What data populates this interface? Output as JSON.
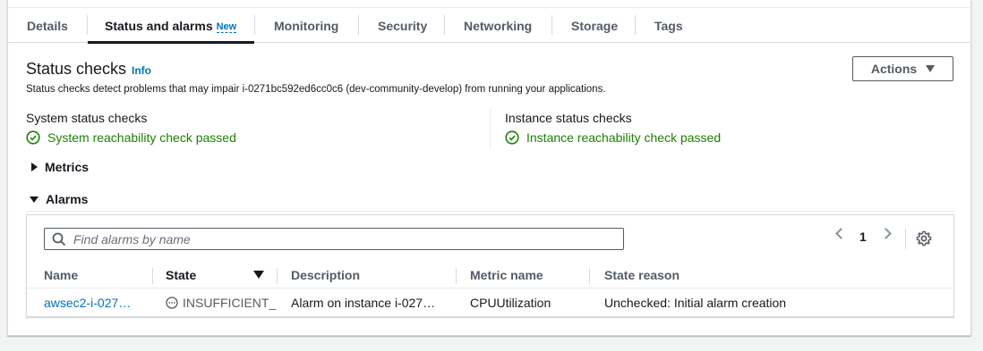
{
  "tabs": [
    {
      "label": "Details"
    },
    {
      "label": "Status and alarms",
      "badge": "New",
      "active": true
    },
    {
      "label": "Monitoring"
    },
    {
      "label": "Security"
    },
    {
      "label": "Networking"
    },
    {
      "label": "Storage"
    },
    {
      "label": "Tags"
    }
  ],
  "header": {
    "title": "Status checks",
    "info": "Info",
    "description": "Status checks detect problems that may impair i-0271bc592ed6cc0c6 (dev-community-develop) from running your applications.",
    "actions_label": "Actions"
  },
  "status_checks": {
    "system": {
      "label": "System status checks",
      "status": "System reachability check passed"
    },
    "instance": {
      "label": "Instance status checks",
      "status": "Instance reachability check passed"
    }
  },
  "sections": {
    "metrics": "Metrics",
    "alarms": "Alarms"
  },
  "alarms": {
    "search_placeholder": "Find alarms by name",
    "page": "1",
    "columns": [
      "Name",
      "State",
      "Description",
      "Metric name",
      "State reason"
    ],
    "rows": [
      {
        "name": "awsec2-i-027…",
        "state": "INSUFFICIENT_D",
        "description": "Alarm on instance i-027…",
        "metric": "CPUUtilization",
        "reason": "Unchecked: Initial alarm creation"
      }
    ]
  },
  "colors": {
    "success": "#1d8102",
    "link": "#0073bb",
    "text": "#16191f",
    "muted": "#545b64"
  }
}
